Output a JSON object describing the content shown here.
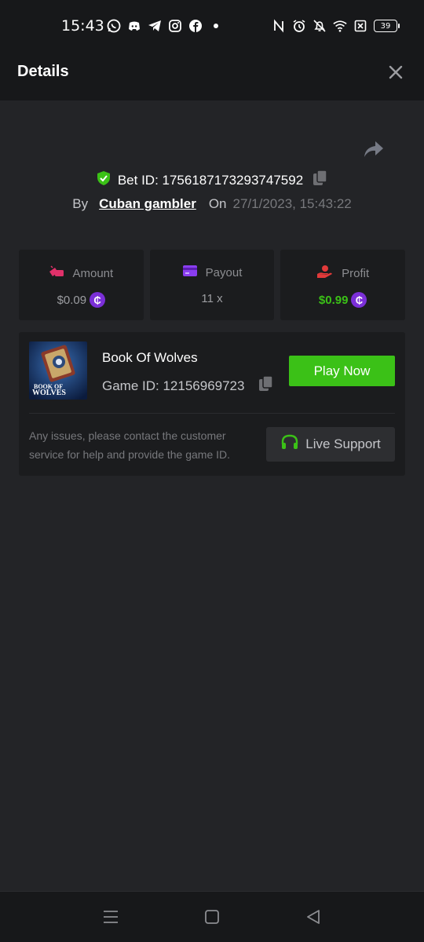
{
  "status_bar": {
    "time": "15:43",
    "battery": "39",
    "left_icons": [
      "whatsapp-icon",
      "discord-icon",
      "telegram-icon",
      "instagram-icon",
      "facebook-icon",
      "dot-icon"
    ],
    "right_icons": [
      "nfc-icon",
      "alarm-icon",
      "mute-icon",
      "wifi-icon",
      "sim-off-icon",
      "battery-icon"
    ]
  },
  "header": {
    "title": "Details"
  },
  "bet": {
    "id_label": "Bet ID: 1756187173293747592",
    "by_label": "By",
    "username": "Cuban gambler",
    "on_label": "On",
    "date": "27/1/2023, 15:43:22"
  },
  "stats": {
    "amount": {
      "label": "Amount",
      "value": "$0.09",
      "icon_color": "#e0316a"
    },
    "payout": {
      "label": "Payout",
      "value": "11 x",
      "icon_color": "#8a3df0"
    },
    "profit": {
      "label": "Profit",
      "value": "$0.99",
      "icon_color": "#e23a3a",
      "value_color": "#3bc117"
    },
    "coin_symbol": "₵"
  },
  "game": {
    "name": "Book Of Wolves",
    "thumb_text_line1": "BOOK OF",
    "thumb_text_line2": "WOLVES",
    "id_label": "Game ID: 12156969723",
    "play_label": "Play Now",
    "support_text": "Any issues, please contact the customer service for help and provide the game ID.",
    "support_label": "Live Support"
  },
  "colors": {
    "accent_green": "#3bc117",
    "coin_purple": "#7b2fd8",
    "background": "#232427",
    "card": "#1b1c1e"
  }
}
